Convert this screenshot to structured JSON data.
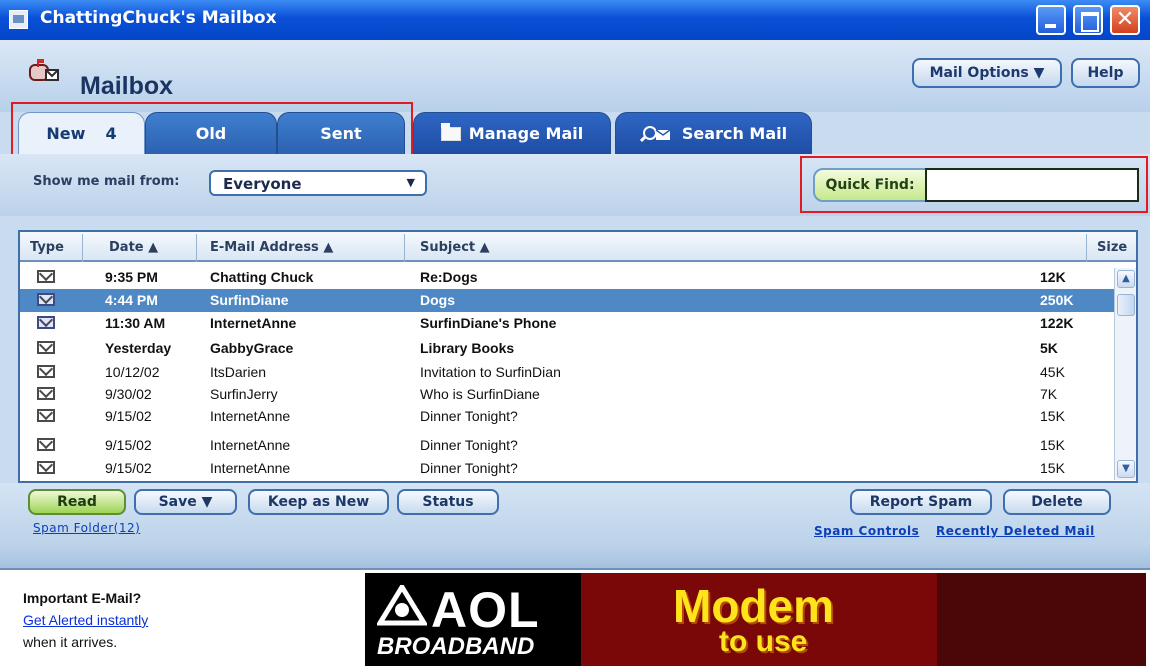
{
  "window": {
    "title": "ChattingChuck's Mailbox",
    "close_glyph": "✕"
  },
  "header": {
    "brand": "Mailbox",
    "mail_options": "Mail Options ▼",
    "help": "Help"
  },
  "tabs": {
    "new": {
      "label": "New",
      "count": "4"
    },
    "old": "Old",
    "sent": "Sent",
    "manage": "Manage Mail",
    "search": "Search Mail"
  },
  "filter": {
    "label": "Show me mail from:",
    "selected": "Everyone"
  },
  "quick_find": {
    "label": "Quick Find:",
    "value": ""
  },
  "columns": {
    "type": "Type",
    "date": "Date ▲",
    "email": "E-Mail Address ▲",
    "subject": "Subject ▲",
    "size": "Size"
  },
  "messages": [
    {
      "time": "9:35 PM",
      "from": "Chatting Chuck",
      "subject": "Re:Dogs",
      "size": "12K"
    },
    {
      "time": "4:44 PM",
      "from": "SurfinDiane",
      "subject": "Dogs",
      "size": "250K"
    },
    {
      "time": "11:30 AM",
      "from": "InternetAnne",
      "subject": "SurfinDiane's Phone",
      "size": "122K"
    },
    {
      "time": "Yesterday",
      "from": "GabbyGrace",
      "subject": "Library Books",
      "size": "5K"
    },
    {
      "time": "10/12/02",
      "from": "ItsDarien",
      "subject": "Invitation to SurfinDian",
      "size": "45K"
    },
    {
      "time": "9/30/02",
      "from": "SurfinJerry",
      "subject": "Who is SurfinDiane",
      "size": "7K"
    },
    {
      "time": "9/15/02",
      "from": "InternetAnne",
      "subject": "Dinner Tonight?",
      "size": "15K"
    },
    {
      "time": "9/15/02",
      "from": "InternetAnne",
      "subject": "Dinner Tonight?",
      "size": "15K"
    },
    {
      "time": "9/15/02",
      "from": "InternetAnne",
      "subject": "Dinner Tonight?",
      "size": "15K"
    }
  ],
  "scroll_glyphs": {
    "up": "▲",
    "down": "▼"
  },
  "actions": {
    "read": "Read",
    "save": "Save ▼",
    "keep_as_new": "Keep as New",
    "status": "Status",
    "report_spam": "Report Spam",
    "delete": "Delete"
  },
  "links": {
    "spam_folder": "Spam Folder(12)",
    "spam_controls": "Spam Controls",
    "recently_deleted": "Recently Deleted Mail"
  },
  "alert": {
    "title": "Important E-Mail?",
    "link": "Get Alerted instantly",
    "subtitle": "when it arrives."
  },
  "ad": {
    "brand": "AOL",
    "tagline": "BROADBAND",
    "headline": "Modem",
    "subheadline": "to use"
  }
}
